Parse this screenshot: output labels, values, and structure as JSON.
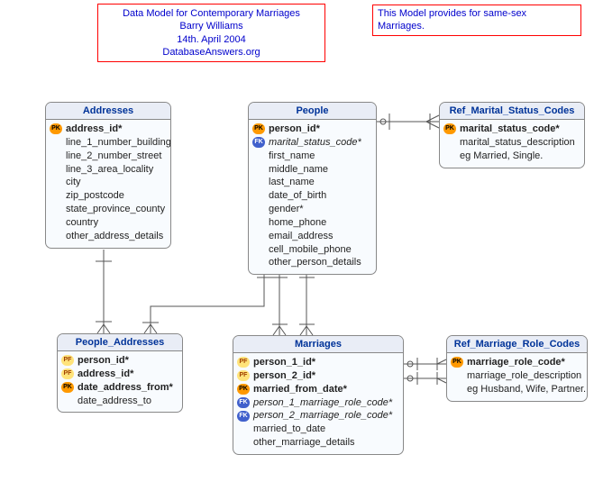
{
  "info_box_1": {
    "line1": "Data Model for Contemporary Marriages",
    "line2": "Barry Williams",
    "line3": "14th. April 2004",
    "line4": "DatabaseAnswers.org"
  },
  "info_box_2": {
    "text": "This Model provides for same-sex Marriages."
  },
  "entities": {
    "addresses": {
      "title": "Addresses",
      "rows": [
        {
          "keytype": "pk",
          "keylabel": "PK",
          "text": "address_id*",
          "bold": true,
          "italic": false
        },
        {
          "keytype": "",
          "keylabel": "",
          "text": "line_1_number_building",
          "bold": false
        },
        {
          "keytype": "",
          "keylabel": "",
          "text": "line_2_number_street",
          "bold": false
        },
        {
          "keytype": "",
          "keylabel": "",
          "text": "line_3_area_locality",
          "bold": false
        },
        {
          "keytype": "",
          "keylabel": "",
          "text": "city",
          "bold": false
        },
        {
          "keytype": "",
          "keylabel": "",
          "text": "zip_postcode",
          "bold": false
        },
        {
          "keytype": "",
          "keylabel": "",
          "text": "state_province_county",
          "bold": false
        },
        {
          "keytype": "",
          "keylabel": "",
          "text": "country",
          "bold": false
        },
        {
          "keytype": "",
          "keylabel": "",
          "text": "other_address_details",
          "bold": false
        }
      ]
    },
    "people": {
      "title": "People",
      "rows": [
        {
          "keytype": "pk",
          "keylabel": "PK",
          "text": "person_id*",
          "bold": true
        },
        {
          "keytype": "fk",
          "keylabel": "FK",
          "text": "marital_status_code*",
          "bold": false,
          "italic": true
        },
        {
          "keytype": "",
          "keylabel": "",
          "text": "first_name",
          "bold": false
        },
        {
          "keytype": "",
          "keylabel": "",
          "text": "middle_name",
          "bold": false
        },
        {
          "keytype": "",
          "keylabel": "",
          "text": "last_name",
          "bold": false
        },
        {
          "keytype": "",
          "keylabel": "",
          "text": "date_of_birth",
          "bold": false
        },
        {
          "keytype": "",
          "keylabel": "",
          "text": "gender*",
          "bold": false
        },
        {
          "keytype": "",
          "keylabel": "",
          "text": "home_phone",
          "bold": false
        },
        {
          "keytype": "",
          "keylabel": "",
          "text": "email_address",
          "bold": false
        },
        {
          "keytype": "",
          "keylabel": "",
          "text": "cell_mobile_phone",
          "bold": false
        },
        {
          "keytype": "",
          "keylabel": "",
          "text": "other_person_details",
          "bold": false
        }
      ]
    },
    "ref_marital_status": {
      "title": "Ref_Marital_Status_Codes",
      "rows": [
        {
          "keytype": "pk",
          "keylabel": "PK",
          "text": "marital_status_code*",
          "bold": true
        },
        {
          "keytype": "",
          "keylabel": "",
          "text": "marital_status_description",
          "bold": false
        },
        {
          "keytype": "",
          "keylabel": "",
          "text": "eg Married, Single.",
          "bold": false
        }
      ]
    },
    "people_addresses": {
      "title": "People_Addresses",
      "rows": [
        {
          "keytype": "pf",
          "keylabel": "PF",
          "text": "person_id*",
          "bold": true
        },
        {
          "keytype": "pf",
          "keylabel": "PF",
          "text": "address_id*",
          "bold": true
        },
        {
          "keytype": "pk",
          "keylabel": "PK",
          "text": "date_address_from*",
          "bold": true
        },
        {
          "keytype": "",
          "keylabel": "",
          "text": "date_address_to",
          "bold": false
        }
      ]
    },
    "marriages": {
      "title": "Marriages",
      "rows": [
        {
          "keytype": "pf",
          "keylabel": "PF",
          "text": "person_1_id*",
          "bold": true
        },
        {
          "keytype": "pf",
          "keylabel": "PF",
          "text": "person_2_id*",
          "bold": true
        },
        {
          "keytype": "pk",
          "keylabel": "PK",
          "text": "married_from_date*",
          "bold": true
        },
        {
          "keytype": "fk",
          "keylabel": "FK",
          "text": "person_1_marriage_role_code*",
          "bold": false,
          "italic": true
        },
        {
          "keytype": "fk",
          "keylabel": "FK",
          "text": "person_2_marriage_role_code*",
          "bold": false,
          "italic": true
        },
        {
          "keytype": "",
          "keylabel": "",
          "text": "married_to_date",
          "bold": false
        },
        {
          "keytype": "",
          "keylabel": "",
          "text": "other_marriage_details",
          "bold": false
        }
      ]
    },
    "ref_marriage_role": {
      "title": "Ref_Marriage_Role_Codes",
      "rows": [
        {
          "keytype": "pk",
          "keylabel": "PK",
          "text": "marriage_role_code*",
          "bold": true
        },
        {
          "keytype": "",
          "keylabel": "",
          "text": "marriage_role_description",
          "bold": false
        },
        {
          "keytype": "",
          "keylabel": "",
          "text": "eg Husband, Wife, Partner.",
          "bold": false
        }
      ]
    }
  }
}
